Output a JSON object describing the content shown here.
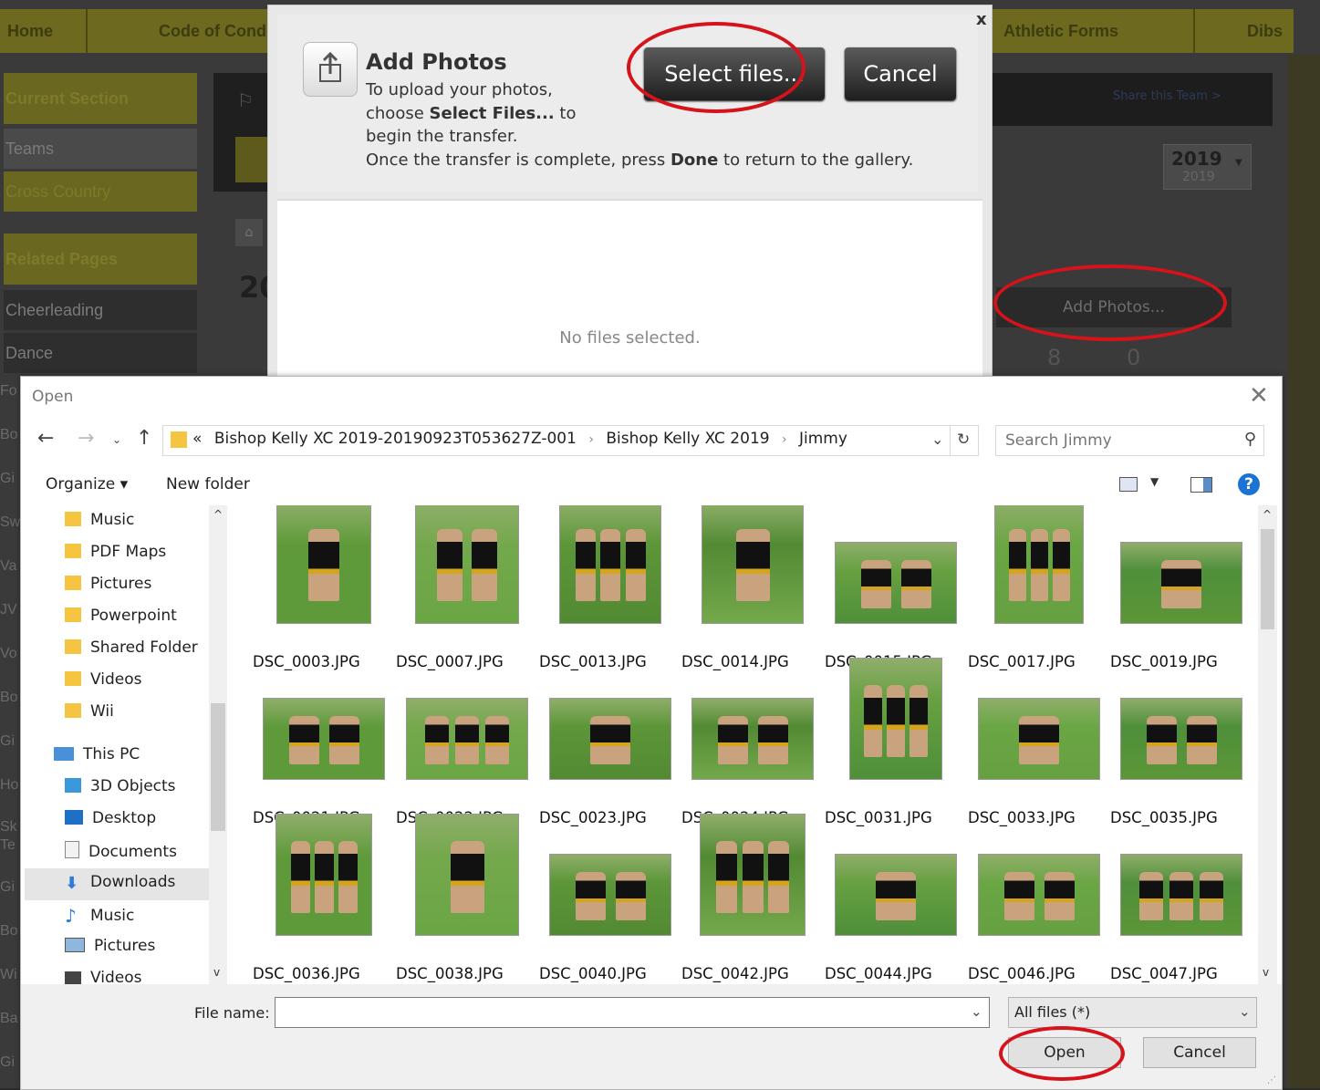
{
  "site": {
    "nav": [
      "Home",
      "Code of Cond",
      "Athletic Forms",
      "Dibs"
    ],
    "sidebar": {
      "current_section": "Current Section",
      "teams": "Teams",
      "cross_country": "Cross Country",
      "related_pages": "Related Pages",
      "cheerleading": "Cheerleading",
      "dance": "Dance"
    },
    "left_letters": [
      "Fo",
      "Bo",
      "Gi",
      "Sw",
      "Va",
      "JV",
      "Vo",
      "Bo",
      "Gi",
      "Ho",
      "Sk",
      "Te",
      "Gi",
      "Bo",
      "Wi",
      "Ba",
      "Gi"
    ],
    "share_link": "Share this Team >",
    "year": "2019",
    "year_sub": "2019",
    "heading_fragment": "20",
    "add_photos_button": "Add Photos...",
    "counts": [
      "8",
      "0"
    ]
  },
  "modal": {
    "title": "Add Photos",
    "line1": "To upload your photos,",
    "line2_pre": "choose ",
    "line2_bold": "Select Files...",
    "line2_post": " to",
    "line3": "begin the transfer.",
    "line4_pre": "Once the transfer is complete, press ",
    "line4_bold": "Done",
    "line4_post": " to return to the gallery.",
    "select_button": "Select files...",
    "cancel_button": "Cancel",
    "close": "x",
    "empty_text": "No files selected."
  },
  "dialog": {
    "title": "Open",
    "close": "✕",
    "address": {
      "prefix": "«",
      "crumbs": [
        "Bishop Kelly XC 2019-20190923T053627Z-001",
        "Bishop Kelly XC 2019",
        "Jimmy"
      ]
    },
    "search_placeholder": "Search Jimmy",
    "toolbar": {
      "organize": "Organize ▾",
      "new_folder": "New folder"
    },
    "nav_items": [
      {
        "label": "Music",
        "icon": "folder-icon"
      },
      {
        "label": "PDF Maps",
        "icon": "folder-icon"
      },
      {
        "label": "Pictures",
        "icon": "folder-icon"
      },
      {
        "label": "Powerpoint",
        "icon": "folder-icon"
      },
      {
        "label": "Shared Folder",
        "icon": "folder-icon"
      },
      {
        "label": "Videos",
        "icon": "folder-icon"
      },
      {
        "label": "Wii",
        "icon": "folder-icon"
      },
      {
        "label": "This PC",
        "icon": "computer-icon"
      },
      {
        "label": "3D Objects",
        "icon": "cube-icon"
      },
      {
        "label": "Desktop",
        "icon": "desktop-icon"
      },
      {
        "label": "Documents",
        "icon": "document-icon"
      },
      {
        "label": "Downloads",
        "icon": "download-icon"
      },
      {
        "label": "Music",
        "icon": "music-icon"
      },
      {
        "label": "Pictures",
        "icon": "picture-icon"
      },
      {
        "label": "Videos",
        "icon": "video-icon"
      }
    ],
    "files": [
      "DSC_0003.JPG",
      "DSC_0007.JPG",
      "DSC_0013.JPG",
      "DSC_0014.JPG",
      "DSC_0015.JPG",
      "DSC_0017.JPG",
      "DSC_0019.JPG",
      "DSC_0021.JPG",
      "DSC_0022.JPG",
      "DSC_0023.JPG",
      "DSC_0024.JPG",
      "DSC_0031.JPG",
      "DSC_0033.JPG",
      "DSC_0035.JPG",
      "DSC_0036.JPG",
      "DSC_0038.JPG",
      "DSC_0040.JPG",
      "DSC_0042.JPG",
      "DSC_0044.JPG",
      "DSC_0046.JPG",
      "DSC_0047.JPG"
    ],
    "file_name_label": "File name:",
    "file_name_value": "",
    "file_type": "All files (*)",
    "open_button": "Open",
    "cancel_button": "Cancel"
  },
  "colors": {
    "accent_red": "#d6121a",
    "help_blue": "#1b73d3",
    "grass": "#5f9a3a"
  }
}
